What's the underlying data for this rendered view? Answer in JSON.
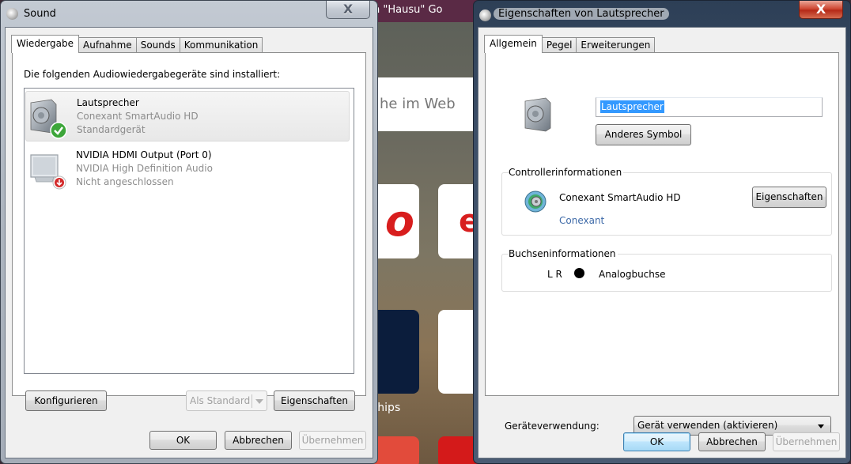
{
  "background_browser": {
    "topbar_text": "h  \"Hausu\"  Go",
    "search_placeholder": "he im Web",
    "tile1_text": "o",
    "tile2_text": "e",
    "caption": "ships"
  },
  "sound_window": {
    "title": "Sound",
    "close_label": "X",
    "tabs": [
      {
        "label": "Wiedergabe",
        "active": true
      },
      {
        "label": "Aufnahme",
        "active": false
      },
      {
        "label": "Sounds",
        "active": false
      },
      {
        "label": "Kommunikation",
        "active": false
      }
    ],
    "intro": "Die folgenden Audiowiedergabegeräte sind installiert:",
    "devices": [
      {
        "name": "Lautsprecher",
        "driver": "Conexant SmartAudio HD",
        "status": "Standardgerät",
        "icon": "speaker-icon",
        "badge": "check-badge-icon",
        "selected": true
      },
      {
        "name": "NVIDIA HDMI Output (Port 0)",
        "driver": "NVIDIA High Definition Audio",
        "status": "Nicht angeschlossen",
        "icon": "monitor-icon",
        "badge": "disconnected-badge-icon",
        "selected": false
      }
    ],
    "buttons": {
      "configure": "Konfigurieren",
      "set_default": "Als Standard",
      "properties": "Eigenschaften",
      "ok": "OK",
      "cancel": "Abbrechen",
      "apply": "Übernehmen"
    }
  },
  "props_window": {
    "title": "Eigenschaften von Lautsprecher",
    "close_label": "X",
    "tabs": [
      {
        "label": "Allgemein",
        "active": true
      },
      {
        "label": "Pegel",
        "active": false
      },
      {
        "label": "Erweiterungen",
        "active": false
      }
    ],
    "name_value": "Lautsprecher",
    "change_icon_button": "Anderes Symbol",
    "controller": {
      "group_label": "Controllerinformationen",
      "name": "Conexant SmartAudio HD",
      "vendor_link": "Conexant",
      "properties_button": "Eigenschaften"
    },
    "jack": {
      "group_label": "Buchseninformationen",
      "channels": "L R",
      "jack_type": "Analogbuchse",
      "jack_color": "#000000"
    },
    "usage": {
      "label": "Geräteverwendung:",
      "selected": "Gerät verwenden (aktivieren)"
    },
    "buttons": {
      "ok": "OK",
      "cancel": "Abbrechen",
      "apply": "Übernehmen"
    }
  },
  "colors": {
    "selection": "#3399ff",
    "link": "#3e6aa8",
    "close_red": "#cf4a35",
    "disabled_text": "#a0a0a0"
  }
}
